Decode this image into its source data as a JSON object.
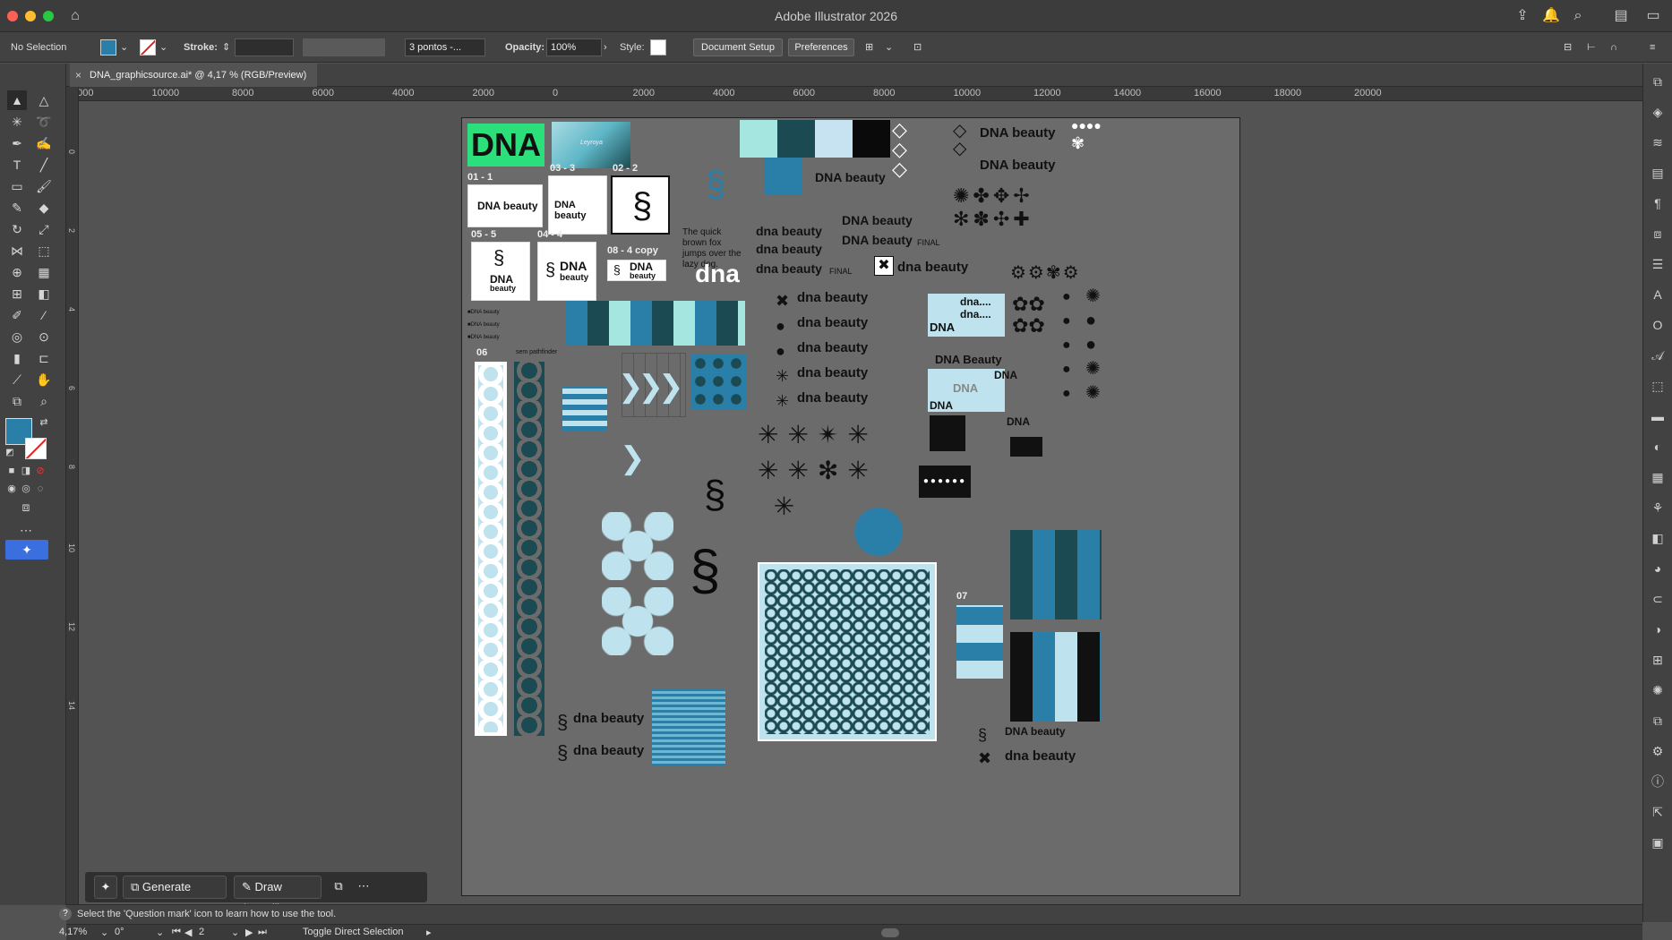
{
  "app": {
    "title": "Adobe Illustrator 2026"
  },
  "control": {
    "selection": "No Selection",
    "stroke_label": "Stroke:",
    "brush_value": "3 pontos -...",
    "opacity_label": "Opacity:",
    "opacity_value": "100%",
    "style_label": "Style:",
    "doc_setup": "Document Setup",
    "preferences": "Preferences"
  },
  "document": {
    "tab_title": "DNA_graphicsource.ai* @ 4,17 % (RGB/Preview)"
  },
  "ruler": {
    "h_ticks": [
      "2000",
      "10000",
      "8000",
      "6000",
      "4000",
      "2000",
      "0",
      "2000",
      "4000",
      "6000",
      "8000",
      "10000",
      "12000",
      "14000",
      "16000",
      "18000",
      "20000"
    ],
    "v_ticks": [
      "0",
      "2",
      "4",
      "6",
      "8",
      "10",
      "12",
      "14"
    ]
  },
  "artboard": {
    "dna_big": "DNA",
    "labels": [
      "01 - 1",
      "03 - 3",
      "02 - 2",
      "05 - 5",
      "04 - 4",
      "08 - 4 copy",
      "06",
      "sem pathfinder",
      "07"
    ],
    "logo_text": "DNA beauty",
    "logo_small": "DNA",
    "logo_small2": "beauty",
    "pangram": "The quick brown fox jumps over the lazy dog.",
    "dna_lower_big": "dna",
    "dna_beauty_lower": "dna beauty",
    "dna_beauty_final": "DNA beauty",
    "final": "FINAL",
    "dna_beauty_title": "DNA Beauty",
    "dna_dots": "dna....",
    "leyoya": "Leyroya",
    "ts_dna": "DNA",
    "dna_lowerA": "DNA"
  },
  "colors": {
    "accent": "#2a7fa8",
    "light": "#bfe3ee",
    "dark": "#1f4e58",
    "green": "#2be07a",
    "mint": "#a6e6e0",
    "teal": "#1b4a52",
    "sky": "#c7e2f0",
    "black": "#0a0a0a"
  },
  "context": {
    "generate": "Generate Vectors",
    "draw": "Draw (Pencil)"
  },
  "status": {
    "hint": "Select the 'Question mark' icon to learn how to use the tool.",
    "zoom": "4,17%",
    "rotation": "0°",
    "page": "2",
    "mode": "Toggle Direct Selection"
  }
}
